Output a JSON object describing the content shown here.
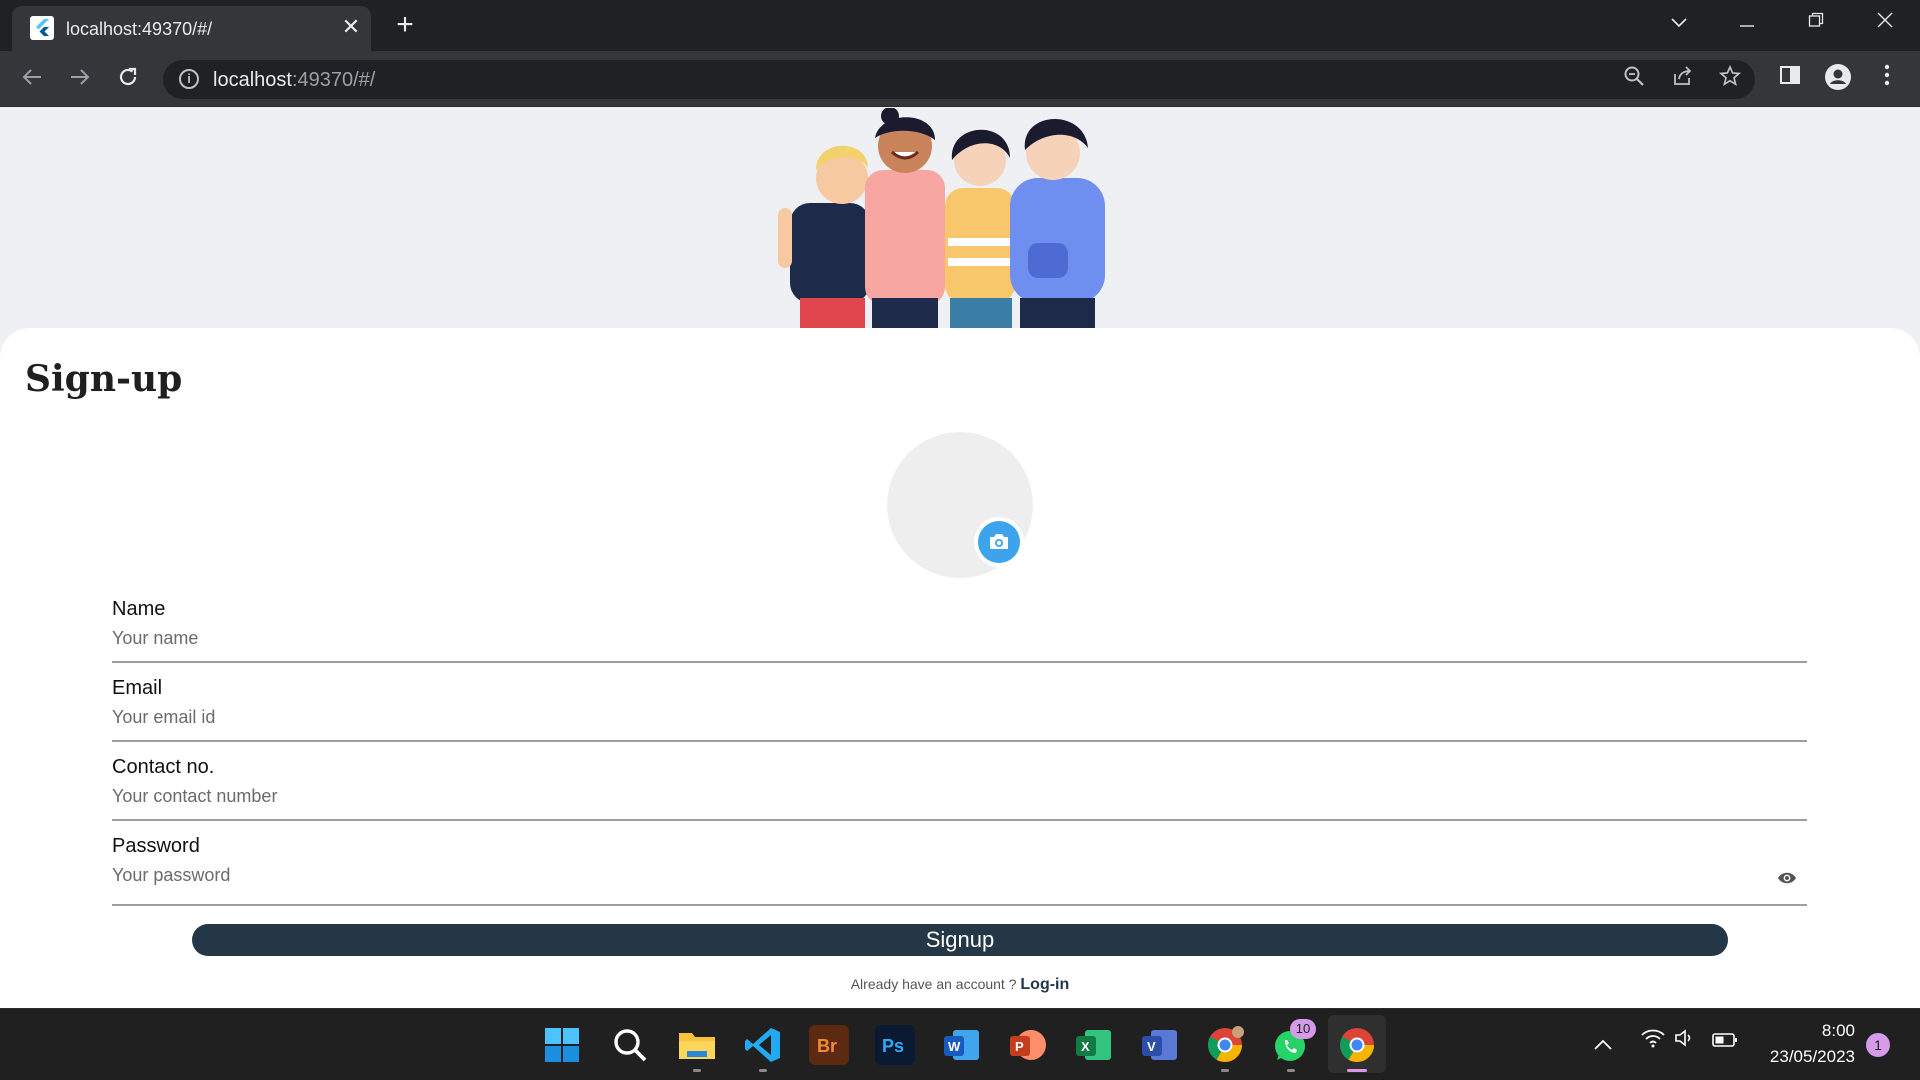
{
  "browser": {
    "tab_title": "localhost:49370/#/",
    "tab_close": "✕",
    "new_tab": "+",
    "url_host": "localhost",
    "url_rest": ":49370/#/"
  },
  "page": {
    "title": "Sign-up",
    "fields": [
      {
        "label": "Name",
        "placeholder": "Your name"
      },
      {
        "label": "Email",
        "placeholder": "Your email id"
      },
      {
        "label": "Contact no.",
        "placeholder": "Your contact number"
      },
      {
        "label": "Password",
        "placeholder": "Your password"
      }
    ],
    "signup_label": "Signup",
    "login_prompt": "Already have an account ?",
    "login_link": "Log-in"
  },
  "taskbar": {
    "whatsapp_badge": "10",
    "time": "8:00",
    "date": "23/05/2023",
    "notification_count": "1"
  },
  "colors": {
    "primary": "#233746",
    "camera": "#3da3ec"
  }
}
